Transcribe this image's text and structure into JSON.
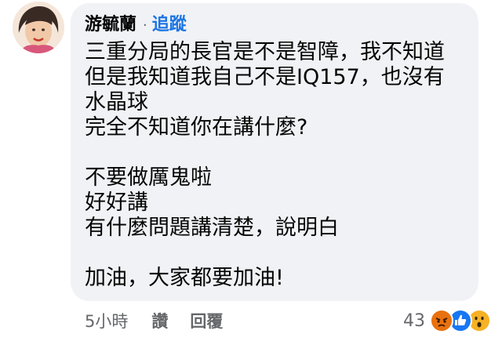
{
  "comment": {
    "author": "游毓蘭",
    "separator": "·",
    "follow_label": "追蹤",
    "lines": [
      "三重分局的長官是不是智障，我不知道",
      "但是我知道我自己不是IQ157，也沒有",
      "水晶球",
      "完全不知道你在講什麼?",
      "",
      "不要做厲鬼啦",
      "好好講",
      "有什麼問題講清楚，說明白",
      "",
      "加油，大家都要加油!"
    ]
  },
  "footer": {
    "time": "5小時",
    "like_label": "讚",
    "reply_label": "回覆",
    "reaction_count": "43"
  },
  "reactions": [
    "angry-icon",
    "like-icon",
    "wow-icon"
  ],
  "colors": {
    "bubble": "#f0f2f5",
    "follow": "#1b74e4",
    "meta": "#65676b"
  }
}
